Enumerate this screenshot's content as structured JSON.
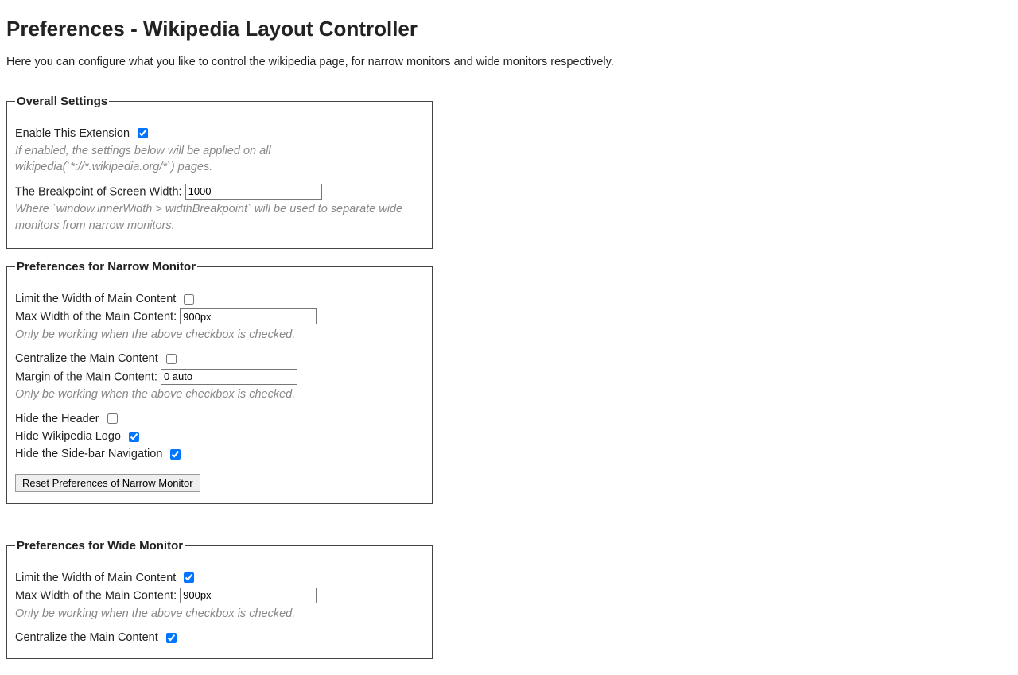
{
  "page": {
    "title": "Preferences - Wikipedia Layout Controller",
    "intro": "Here you can configure what you like to control the wikipedia page, for narrow monitors and wide monitors respectively."
  },
  "overall": {
    "legend": "Overall Settings",
    "enable_label": "Enable This Extension",
    "enable_checked": true,
    "enable_hint": "If enabled, the settings below will be applied on all wikipedia(`*://*.wikipedia.org/*`) pages.",
    "breakpoint_label": "The Breakpoint of Screen Width:",
    "breakpoint_value": "1000",
    "breakpoint_hint": "Where `window.innerWidth > widthBreakpoint` will be used to separate wide monitors from narrow monitors."
  },
  "narrow": {
    "legend": "Preferences for Narrow Monitor",
    "limit_label": "Limit the Width of Main Content",
    "limit_checked": false,
    "maxw_label": "Max Width of the Main Content:",
    "maxw_value": "900px",
    "maxw_hint": "Only be working when the above checkbox is checked.",
    "central_label": "Centralize the Main Content",
    "central_checked": false,
    "margin_label": "Margin of the Main Content:",
    "margin_value": "0 auto",
    "margin_hint": "Only be working when the above checkbox is checked.",
    "hide_header_label": "Hide the Header",
    "hide_header_checked": false,
    "hide_logo_label": "Hide Wikipedia Logo",
    "hide_logo_checked": true,
    "hide_sidebar_label": "Hide the Side-bar Navigation",
    "hide_sidebar_checked": true,
    "reset_button": "Reset Preferences of Narrow Monitor"
  },
  "wide": {
    "legend": "Preferences for Wide Monitor",
    "limit_label": "Limit the Width of Main Content",
    "limit_checked": true,
    "maxw_label": "Max Width of the Main Content:",
    "maxw_value": "900px",
    "maxw_hint": "Only be working when the above checkbox is checked.",
    "central_label": "Centralize the Main Content",
    "central_checked": true
  }
}
